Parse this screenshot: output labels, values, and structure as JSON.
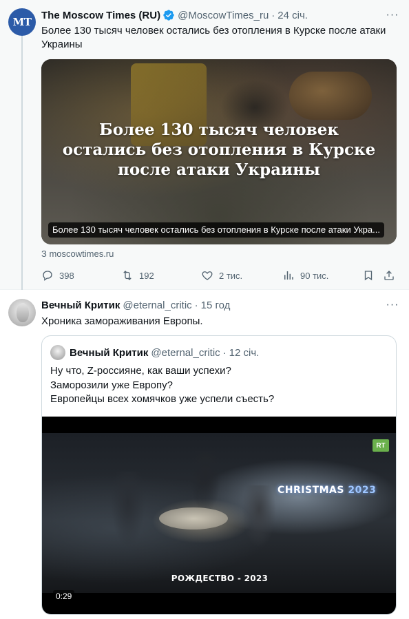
{
  "tweet1": {
    "avatar_text": "MT",
    "author_name": "The Moscow Times (RU)",
    "handle": "@MoscowTimes_ru",
    "separator": "·",
    "time": "24 січ.",
    "text_line1": "Более 130 тысяч человек остались без отопления в Курске после атаки",
    "text_line2": "Украины",
    "media": {
      "headline_line1": "Более 130 тысяч человек",
      "headline_line2": "остались без отопления в Курске",
      "headline_line3": "после атаки Украины",
      "caption": "Более 130 тысяч человек остались без отопления в Курске после атаки Укра..."
    },
    "source": "З moscowtimes.ru",
    "actions": {
      "replies": "398",
      "retweets": "192",
      "likes": "2 тис.",
      "views": "90 тис."
    }
  },
  "tweet2": {
    "author_name": "Вечный Критик",
    "handle": "@eternal_critic",
    "separator": "·",
    "time": "15 год",
    "text": "Хроника замораживания Европы.",
    "quote": {
      "author_name": "Вечный Критик",
      "handle": "@eternal_critic",
      "separator": "·",
      "time": "12 січ.",
      "line1": "Ну что, Z-россияне, как ваши успехи?",
      "line2": "Заморозили уже Европу?",
      "line3": "Европейцы всех хомячков уже успели съесть?",
      "video": {
        "logo": "RT",
        "overlay_word": "CHRISTMAS",
        "overlay_year": "2023",
        "subtitle": "РОЖДЕСТВО - 2023",
        "duration": "0:29"
      }
    }
  },
  "colors": {
    "verified": "#1d9bf0",
    "secondary_text": "#536471",
    "mt_avatar": "#2c5ba8",
    "rt_logo": "#6ab04c"
  },
  "icons": {
    "verified": "verified-badge-icon",
    "more": "more-dots-icon",
    "reply": "reply-icon",
    "retweet": "retweet-icon",
    "like": "heart-icon",
    "views": "views-chart-icon",
    "bookmark": "bookmark-icon",
    "share": "share-icon"
  }
}
